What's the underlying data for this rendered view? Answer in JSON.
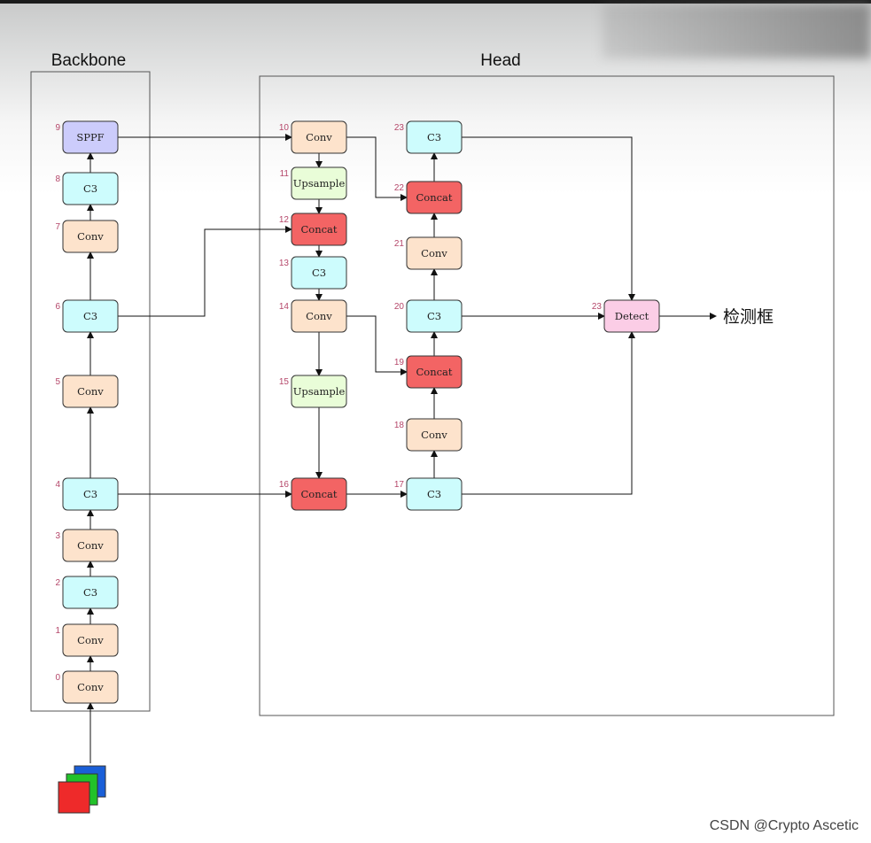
{
  "titles": {
    "backbone": "Backbone",
    "head": "Head"
  },
  "output_label": "检测框",
  "watermark": "CSDN @Crypto Ascetic",
  "colors": {
    "Conv": "#fde3cc",
    "C3": "#cdfcfd",
    "SPPF": "#ccccfb",
    "Upsample": "#e9fdd8",
    "Concat": "#f36464",
    "Detect": "#fbcde6",
    "index": "#b5476a"
  },
  "nodes": [
    {
      "id": "b0",
      "index": "0",
      "label": "Conv"
    },
    {
      "id": "b1",
      "index": "1",
      "label": "Conv"
    },
    {
      "id": "b2",
      "index": "2",
      "label": "C3"
    },
    {
      "id": "b3",
      "index": "3",
      "label": "Conv"
    },
    {
      "id": "b4",
      "index": "4",
      "label": "C3"
    },
    {
      "id": "b5",
      "index": "5",
      "label": "Conv"
    },
    {
      "id": "b6",
      "index": "6",
      "label": "C3"
    },
    {
      "id": "b7",
      "index": "7",
      "label": "Conv"
    },
    {
      "id": "b8",
      "index": "8",
      "label": "C3"
    },
    {
      "id": "b9",
      "index": "9",
      "label": "SPPF"
    },
    {
      "id": "h10",
      "index": "10",
      "label": "Conv"
    },
    {
      "id": "h11",
      "index": "11",
      "label": "Upsample"
    },
    {
      "id": "h12",
      "index": "12",
      "label": "Concat"
    },
    {
      "id": "h13",
      "index": "13",
      "label": "C3"
    },
    {
      "id": "h14",
      "index": "14",
      "label": "Conv"
    },
    {
      "id": "h15",
      "index": "15",
      "label": "Upsample"
    },
    {
      "id": "h16",
      "index": "16",
      "label": "Concat"
    },
    {
      "id": "h17",
      "index": "17",
      "label": "C3"
    },
    {
      "id": "h18",
      "index": "18",
      "label": "Conv"
    },
    {
      "id": "h19",
      "index": "19",
      "label": "Concat"
    },
    {
      "id": "h20",
      "index": "20",
      "label": "C3"
    },
    {
      "id": "h21",
      "index": "21",
      "label": "Conv"
    },
    {
      "id": "h22",
      "index": "22",
      "label": "Concat"
    },
    {
      "id": "h23",
      "index": "23",
      "label": "C3"
    },
    {
      "id": "det",
      "index": "23",
      "label": "Detect"
    }
  ]
}
